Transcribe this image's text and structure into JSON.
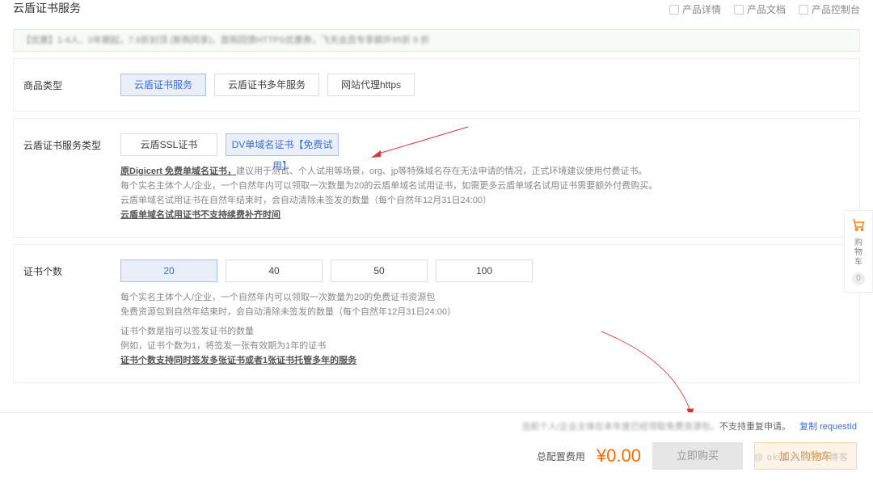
{
  "header": {
    "title": "云盾证书服务",
    "links": [
      "产品详情",
      "产品文档",
      "产品控制台"
    ]
  },
  "banner": {
    "text": "【优惠】1-4人、0年期起，7.6折封顶 (新购同享)，首购回馈HTTPS优惠券，飞天会员专享额外95折 9 折"
  },
  "productType": {
    "label": "商品类型",
    "options": [
      "云盾证书服务",
      "云盾证书多年服务",
      "网站代理https"
    ],
    "active": 0
  },
  "serviceType": {
    "label": "云盾证书服务类型",
    "options": [
      "云盾SSL证书",
      "DV单域名证书【免费试用】"
    ],
    "active": 1,
    "desc1a": "原Digicert 免费单域名证书，",
    "desc1b": "建议用于测试、个人试用等场景，org、jp等特殊域名存在无法申请的情况，正式环境建议使用付费证书。",
    "desc2": "每个实名主体个人/企业，一个自然年内可以领取一次数量为20的云盾单域名试用证书，如需更多云盾单域名试用证书需要额外付费购买。",
    "desc3": "云盾单域名试用证书在自然年结束时，会自动清除未签发的数量（每个自然年12月31日24:00）",
    "desc4": "云盾单域名试用证书不支持续费补齐时间"
  },
  "certCount": {
    "label": "证书个数",
    "options": [
      "20",
      "40",
      "50",
      "100"
    ],
    "active": 0,
    "desc1": "每个实名主体个人/企业，一个自然年内可以领取一次数量为20的免费证书资源包",
    "desc2": "免费资源包到自然年结束时，会自动清除未签发的数量（每个自然年12月31日24:00）",
    "desc3": "证书个数是指可以签发证书的数量",
    "desc4": "例如，证书个数为1，将签发一张有效期为1年的证书",
    "desc5": "证书个数支持同时签发多张证书或者1张证书托管多年的服务"
  },
  "cart": {
    "label1": "购",
    "label2": "物",
    "label3": "车",
    "count": "0"
  },
  "footer": {
    "msg_blur": "当前个人/企业主体在本年度已经领取免费资源包，",
    "msg_tail": "不支持重复申请。",
    "copy": "复制 requestId",
    "total_label": "总配置费用",
    "price": "¥0.00",
    "buy": "立即购买",
    "add": "加入购物车"
  },
  "watermark": "@ oki别别别别的博客"
}
